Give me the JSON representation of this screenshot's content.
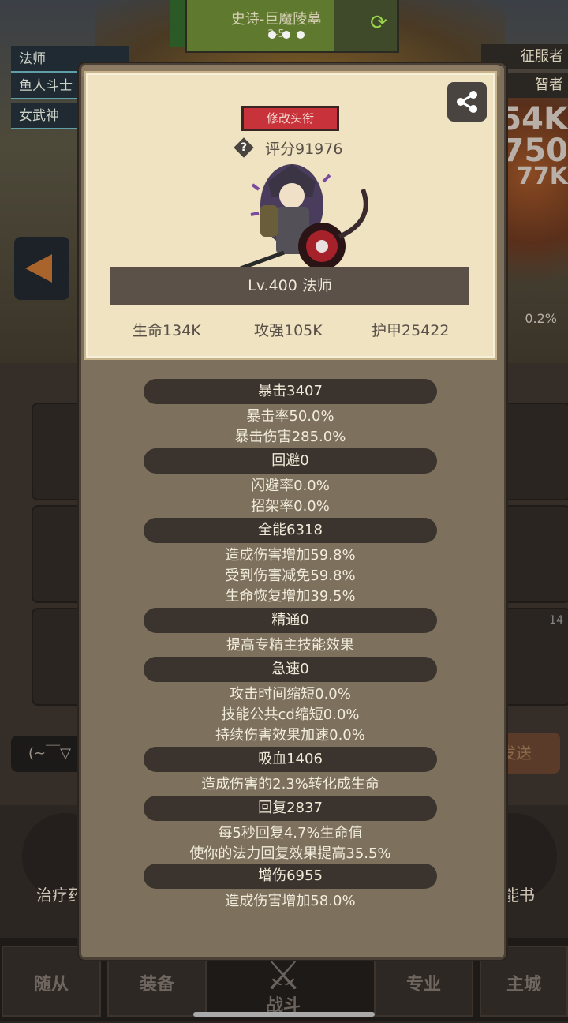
{
  "background": {
    "stage_title": "史诗-巨魔陵墓",
    "stage_sub": "2-5",
    "class_list": [
      "法师",
      "鱼人斗士",
      "女武神"
    ],
    "right_tags": [
      "征服者",
      "智者"
    ],
    "damage_numbers": [
      "54K",
      "750",
      "77K"
    ],
    "percent": "0.2%",
    "slot_badge": "14",
    "left_pill": "(~￣▽",
    "right_pill": "发送",
    "left_round_label": "治疗药",
    "right_round_label": "能书",
    "tabs": [
      "随从",
      "装备",
      "战斗",
      "专业",
      "主城"
    ]
  },
  "modal": {
    "title_button": "修改头衔",
    "score": "评分91976",
    "level_class": "Lv.400 法师",
    "stats": {
      "hp": "生命134K",
      "attack": "攻强105K",
      "armor": "护甲25422"
    },
    "sections": [
      {
        "header": "暴击3407",
        "lines": [
          "暴击率50.0%",
          "暴击伤害285.0%"
        ]
      },
      {
        "header": "回避0",
        "lines": [
          "闪避率0.0%",
          "招架率0.0%"
        ]
      },
      {
        "header": "全能6318",
        "lines": [
          "造成伤害增加59.8%",
          "受到伤害减免59.8%",
          "生命恢复增加39.5%"
        ]
      },
      {
        "header": "精通0",
        "lines": [
          "提高专精主技能效果"
        ]
      },
      {
        "header": "急速0",
        "lines": [
          "攻击时间缩短0.0%",
          "技能公共cd缩短0.0%",
          "持续伤害效果加速0.0%"
        ]
      },
      {
        "header": "吸血1406",
        "lines": [
          "造成伤害的2.3%转化成生命"
        ]
      },
      {
        "header": "回复2837",
        "lines": [
          "每5秒回复4.7%生命值",
          "使你的法力回复效果提高35.5%"
        ]
      },
      {
        "header": "增伤6955",
        "lines": [
          "造成伤害增加58.0%"
        ]
      }
    ]
  },
  "colors": {
    "panel": "#7d705d",
    "card": "#efe3c2",
    "title_button": "#c8323a",
    "section_bar": "#3b342e"
  },
  "icons": [
    "share-icon",
    "help-icon",
    "refresh-icon",
    "swords-icon"
  ]
}
